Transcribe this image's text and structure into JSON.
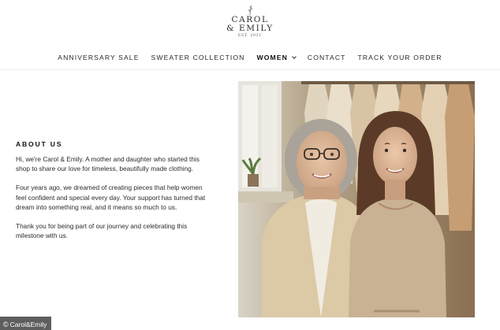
{
  "brand": {
    "name_line1": "CAROL",
    "name_line2": "& EMILY",
    "established": "EST. 2021"
  },
  "nav": {
    "items": [
      {
        "label": "ANNIVERSARY SALE"
      },
      {
        "label": "SWEATER COLLECTION"
      },
      {
        "label": "WOMEN",
        "dropdown": true
      },
      {
        "label": "CONTACT"
      },
      {
        "label": "TRACK YOUR ORDER"
      }
    ]
  },
  "about": {
    "heading": "ABOUT US",
    "paragraphs": [
      "Hi, we're Carol & Emily. A mother and daughter who started this shop to share our love for timeless, beautifully made clothing.",
      "Four years ago, we dreamed of creating pieces that help women feel confident and special every day. Your support has turned that dream into something real, and it means so much to us.",
      "Thank you for being part of our journey and celebrating this milestone with us."
    ]
  },
  "credit": {
    "symbol": "©",
    "text": "Carol&Emily"
  },
  "icons": {
    "logo_sprig": "sprig-icon",
    "dropdown": "chevron-down-icon"
  }
}
